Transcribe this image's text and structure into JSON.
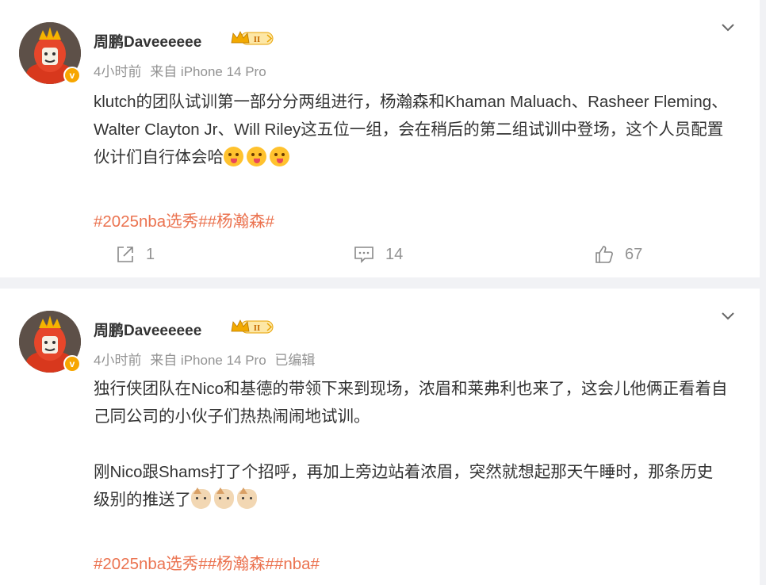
{
  "posts": [
    {
      "author": "周鹏Daveeeeee",
      "time": "4小时前",
      "source": "来自 iPhone 14 Pro",
      "edited": "",
      "paragraphs": [
        "klutch的团队试训第一部分分两组进行，杨瀚森和Khaman Maluach、Rasheer Fleming、Walter Clayton Jr、Will Riley这五位一组，会在稍后的第二组试训中登场，这个人员配置伙计们自行体会哈"
      ],
      "tags": "#2025nba选秀##杨瀚森#",
      "repost_count": "1",
      "comment_count": "14",
      "like_count": "67"
    },
    {
      "author": "周鹏Daveeeeee",
      "time": "4小时前",
      "source": "来自 iPhone 14 Pro",
      "edited": "已编辑",
      "paragraphs": [
        "独行侠团队在Nico和基德的带领下来到现场，浓眉和莱弗利也来了，这会儿他俩正看着自己同公司的小伙子们热热闹闹地试训。",
        "刚Nico跟Shams打了个招呼，再加上旁边站着浓眉，突然就想起那天午睡时，那条历史级别的推送了"
      ],
      "tags": "#2025nba选秀##杨瀚森##nba#"
    }
  ],
  "icons": {
    "more": "chevron-down-icon",
    "repost": "repost-icon",
    "comment": "comment-icon",
    "like": "thumbs-up-icon",
    "verified": "verified-badge-icon",
    "crown": "vip-crown-icon"
  },
  "colors": {
    "tag": "#eb7350",
    "meta": "#939393",
    "verified": "#f7a600",
    "background": "#f1f2f5"
  }
}
